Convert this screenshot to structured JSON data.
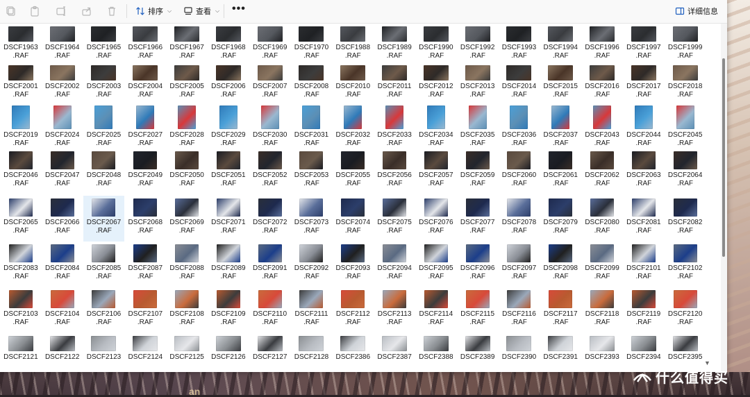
{
  "toolbar": {
    "sort_label": "排序",
    "view_label": "查看",
    "more_label": "•••",
    "details_label": "详细信息"
  },
  "watermark": {
    "text": "什么值得买"
  },
  "wallpaper_text": "an",
  "selected": "DSCF2067",
  "ext": ".RAF",
  "rows": [
    [
      "DSCF1963",
      "DSCF1964",
      "DSCF1965",
      "DSCF1966",
      "DSCF1967",
      "DSCF1968",
      "DSCF1969",
      "DSCF1970",
      "DSCF1988",
      "DSCF1989",
      "DSCF1990",
      "DSCF1992",
      "DSCF1993",
      "DSCF1994",
      "DSCF1996",
      "DSCF1997",
      "DSCF1999"
    ],
    [
      "DSCF2001",
      "DSCF2002",
      "DSCF2003",
      "DSCF2004",
      "DSCF2005",
      "DSCF2006",
      "DSCF2007",
      "DSCF2008",
      "DSCF2010",
      "DSCF2011",
      "DSCF2012",
      "DSCF2013",
      "DSCF2014",
      "DSCF2015",
      "DSCF2016",
      "DSCF2017",
      "DSCF2018"
    ],
    [
      "DSCF2019",
      "DSCF2024",
      "DSCF2025",
      "DSCF2027",
      "DSCF2028",
      "DSCF2029",
      "DSCF2030",
      "DSCF2031",
      "DSCF2032",
      "DSCF2033",
      "DSCF2034",
      "DSCF2035",
      "DSCF2036",
      "DSCF2037",
      "DSCF2043",
      "DSCF2044",
      "DSCF2045"
    ],
    [
      "DSCF2046",
      "DSCF2047",
      "DSCF2048",
      "DSCF2049",
      "DSCF2050",
      "DSCF2051",
      "DSCF2052",
      "DSCF2053",
      "DSCF2055",
      "DSCF2056",
      "DSCF2057",
      "DSCF2059",
      "DSCF2060",
      "DSCF2061",
      "DSCF2062",
      "DSCF2063",
      "DSCF2064"
    ],
    [
      "DSCF2065",
      "DSCF2066",
      "DSCF2067",
      "DSCF2068",
      "DSCF2069",
      "DSCF2071",
      "DSCF2072",
      "DSCF2073",
      "DSCF2074",
      "DSCF2075",
      "DSCF2076",
      "DSCF2077",
      "DSCF2078",
      "DSCF2079",
      "DSCF2080",
      "DSCF2081",
      "DSCF2082"
    ],
    [
      "DSCF2083",
      "DSCF2084",
      "DSCF2085",
      "DSCF2087",
      "DSCF2088",
      "DSCF2089",
      "DSCF2091",
      "DSCF2092",
      "DSCF2093",
      "DSCF2094",
      "DSCF2095",
      "DSCF2096",
      "DSCF2097",
      "DSCF2098",
      "DSCF2099",
      "DSCF2101",
      "DSCF2102"
    ],
    [
      "DSCF2103",
      "DSCF2104",
      "DSCF2106",
      "DSCF2107",
      "DSCF2108",
      "DSCF2109",
      "DSCF2110",
      "DSCF2111",
      "DSCF2112",
      "DSCF2113",
      "DSCF2114",
      "DSCF2115",
      "DSCF2116",
      "DSCF2117",
      "DSCF2118",
      "DSCF2119",
      "DSCF2120"
    ],
    [
      "DSCF2121",
      "DSCF2122",
      "DSCF2123",
      "DSCF2124",
      "DSCF2125",
      "DSCF2126",
      "DSCF2127",
      "DSCF2128",
      "DSCF2386",
      "DSCF2387",
      "DSCF2388",
      "DSCF2389",
      "DSCF2390",
      "DSCF2391",
      "DSCF2393",
      "DSCF2394",
      "DSCF2395"
    ]
  ],
  "row_palettes": [
    [
      "#3a3c40",
      "#6b6e74",
      "#2b2d30",
      "#55585e",
      "#1f2124"
    ],
    [
      "#4a3528",
      "#6e5a4a",
      "#2e2a28",
      "#8a7560",
      "#3c3c3c"
    ],
    [
      "#2f7ab8",
      "#d8383a",
      "#4aa0d8",
      "#9ab8d0",
      "#5c8fb5"
    ],
    [
      "#1a1c22",
      "#3a2e28",
      "#5a4a3e",
      "#22252d",
      "#6a5a4c"
    ],
    [
      "#2c3e6a",
      "#2a2f3a",
      "#e4e6ea",
      "#1e2a4e",
      "#5a6e9a"
    ],
    [
      "#202020",
      "#5a6a82",
      "#d0d4da",
      "#1c3e8a",
      "#8a8e96"
    ],
    [
      "#b85a30",
      "#c96b3c",
      "#3c3c3c",
      "#d84a3a",
      "#9aa8ba"
    ],
    [
      "#cfd3d8",
      "#e6e7ea",
      "#8a8e92",
      "#3a3c40",
      "#b8bcc2"
    ]
  ]
}
